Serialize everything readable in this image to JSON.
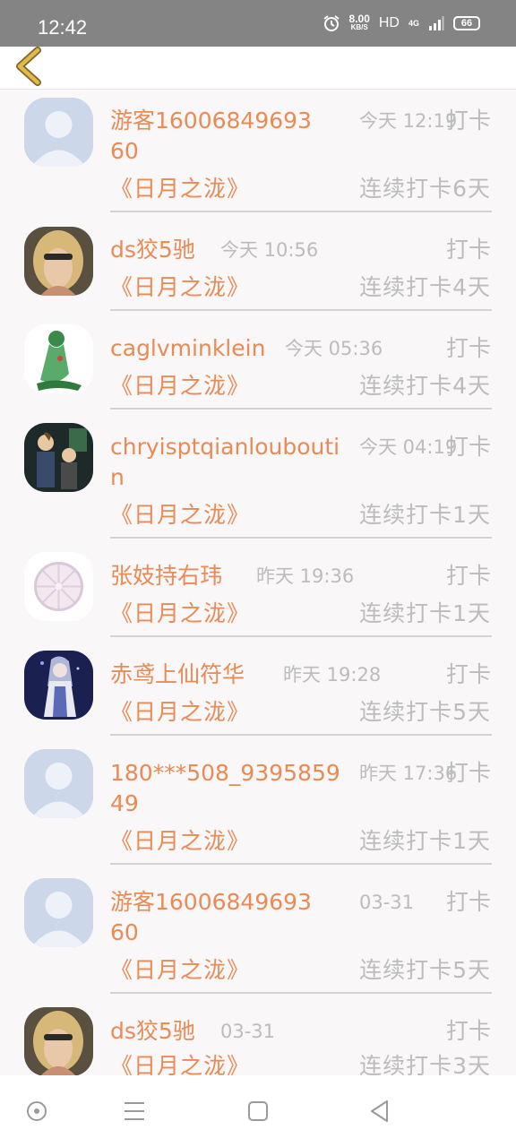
{
  "status_bar": {
    "time": "12:42",
    "speed_value": "8.00",
    "speed_unit": "KB/S",
    "hd": "HD",
    "network": "4G",
    "battery": "66",
    "icons": [
      "alarm-icon",
      "signal-icon",
      "battery-icon"
    ]
  },
  "header": {
    "back_icon": "chevron-left-icon",
    "accent": "#e6b84a"
  },
  "colors": {
    "accent": "#ea8a54",
    "muted": "#bcbcbc",
    "status_bar": "#848484"
  },
  "items": [
    {
      "name": "游客1600684969360",
      "time": "今天 12:19",
      "action": "打卡",
      "book": "《日月之泷》",
      "streak": "连续打卡6天",
      "avatar": "default-avatar"
    },
    {
      "name": "ds狡5驰",
      "time": "今天 10:56",
      "action": "打卡",
      "book": "《日月之泷》",
      "streak": "连续打卡4天",
      "avatar": "photo-avatar"
    },
    {
      "name": "caglvminklein",
      "time": "今天 05:36",
      "action": "打卡",
      "book": "《日月之泷》",
      "streak": "连续打卡4天",
      "avatar": "anime-avatar"
    },
    {
      "name": "chryisptqianlouboutin",
      "time": "今天 04:19",
      "action": "打卡",
      "book": "《日月之泷》",
      "streak": "连续打卡1天",
      "avatar": "photo-avatar"
    },
    {
      "name": "张妓持右玮",
      "time": "昨天 19:36",
      "action": "打卡",
      "book": "《日月之泷》",
      "streak": "连续打卡1天",
      "avatar": "lemon-avatar"
    },
    {
      "name": "赤鸢上仙符华",
      "time": "昨天 19:28",
      "action": "打卡",
      "book": "《日月之泷》",
      "streak": "连续打卡5天",
      "avatar": "anime-avatar"
    },
    {
      "name": "180***508_939585949",
      "time": "昨天 17:36",
      "action": "打卡",
      "book": "《日月之泷》",
      "streak": "连续打卡1天",
      "avatar": "default-avatar"
    },
    {
      "name": "游客1600684969360",
      "time": "03-31",
      "action": "打卡",
      "book": "《日月之泷》",
      "streak": "连续打卡5天",
      "avatar": "default-avatar"
    },
    {
      "name": "ds狡5驰",
      "time": "03-31",
      "action": "打卡",
      "book": "《日月之泷》",
      "streak": "连续打卡3天",
      "avatar": "photo-avatar"
    }
  ],
  "bottom_nav": [
    "home-circle-icon",
    "menu-icon",
    "square-icon",
    "back-triangle-icon"
  ]
}
